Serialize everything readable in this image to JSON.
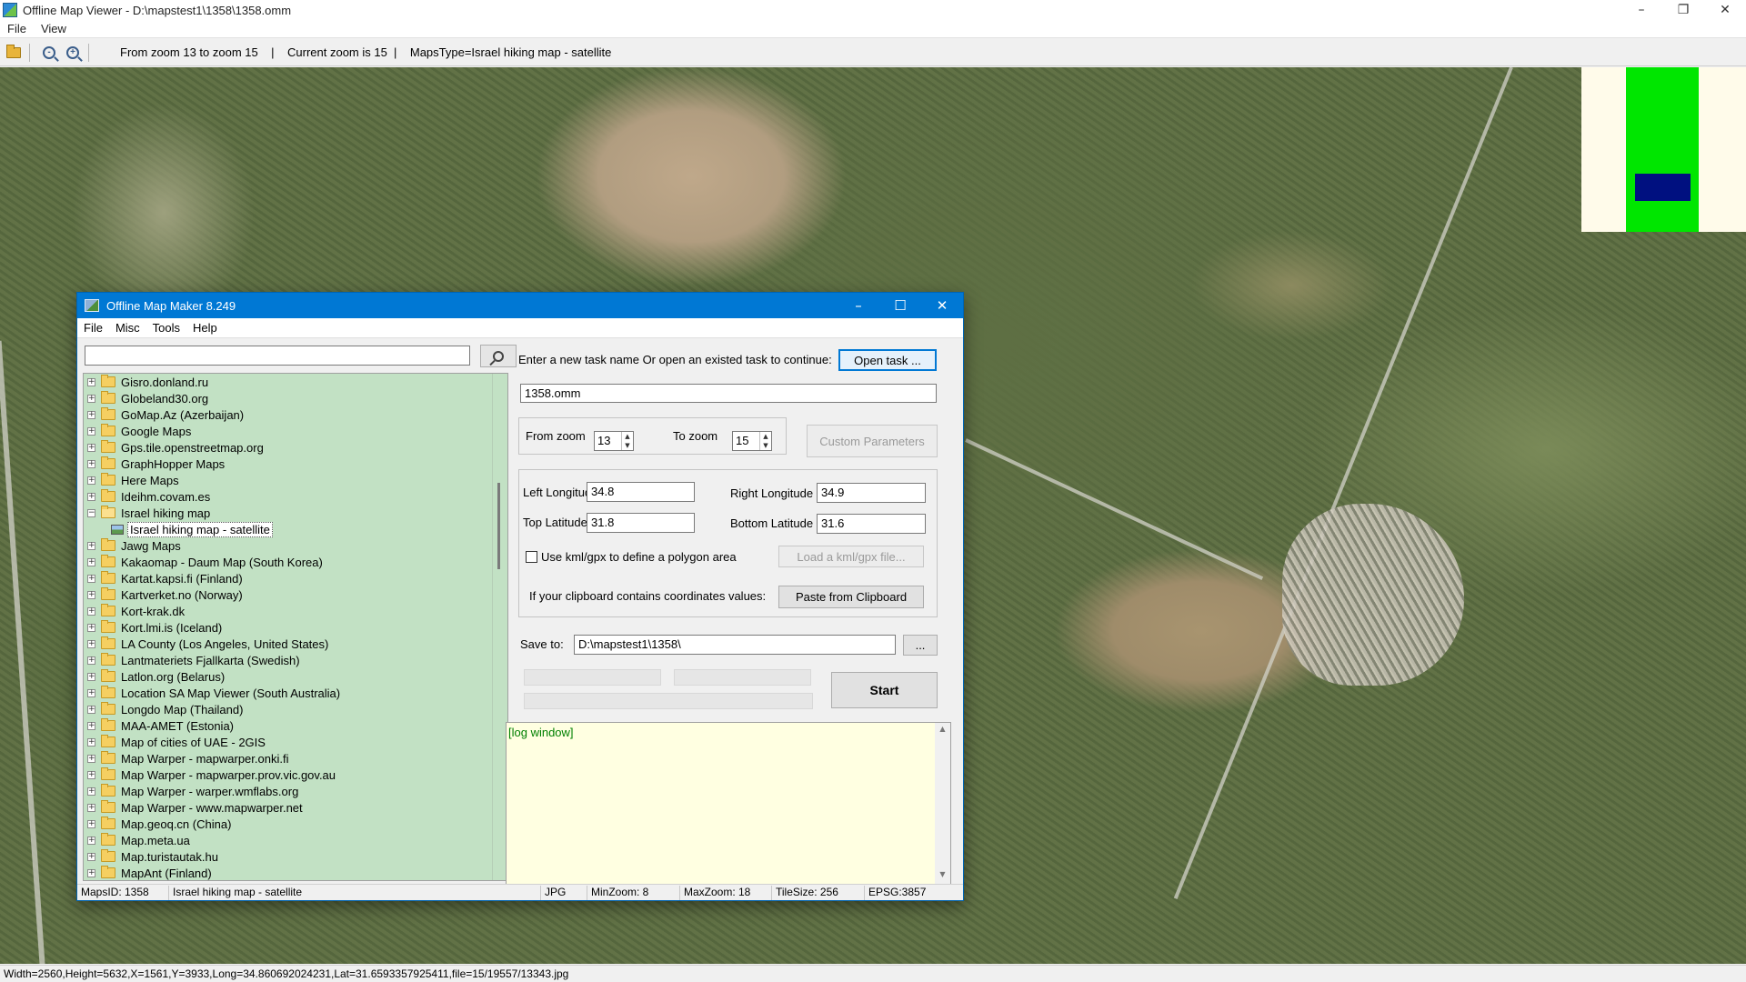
{
  "viewer": {
    "title": "Offline Map Viewer - D:\\mapstest1\\1358\\1358.omm",
    "menu": [
      "File",
      "View"
    ],
    "toolbar_status": "From zoom 13 to zoom 15    |    Current zoom is 15  |    MapsType=Israel hiking map - satellite",
    "statusbar": "Width=2560,Height=5632,X=1561,Y=3933,Long=34.860692024231,Lat=31.6593357925411,file=15/19557/13343.jpg",
    "minimap_colors": {
      "background": "#fffbea",
      "extent": "#00e600",
      "viewport": "#001080"
    }
  },
  "dialog": {
    "title": "Offline Map Maker 8.249",
    "menu": [
      "File",
      "Misc",
      "Tools",
      "Help"
    ],
    "search_value": "",
    "tree": [
      {
        "label": "Gisro.donland.ru"
      },
      {
        "label": "Globeland30.org"
      },
      {
        "label": "GoMap.Az (Azerbaijan)"
      },
      {
        "label": "Google Maps"
      },
      {
        "label": "Gps.tile.openstreetmap.org"
      },
      {
        "label": "GraphHopper Maps"
      },
      {
        "label": "Here Maps"
      },
      {
        "label": "Ideihm.covam.es"
      },
      {
        "label": "Israel hiking map",
        "expanded": true
      },
      {
        "label": "Israel hiking map - satellite",
        "child": true
      },
      {
        "label": "Jawg Maps"
      },
      {
        "label": "Kakaomap - Daum Map (South Korea)"
      },
      {
        "label": "Kartat.kapsi.fi (Finland)"
      },
      {
        "label": "Kartverket.no (Norway)"
      },
      {
        "label": "Kort-krak.dk"
      },
      {
        "label": "Kort.lmi.is (Iceland)"
      },
      {
        "label": "LA County (Los Angeles, United States)"
      },
      {
        "label": "Lantmateriets Fjallkarta (Swedish)"
      },
      {
        "label": "Latlon.org (Belarus)"
      },
      {
        "label": "Location SA Map Viewer (South Australia)"
      },
      {
        "label": "Longdo Map (Thailand)"
      },
      {
        "label": "MAA-AMET (Estonia)"
      },
      {
        "label": "Map of cities of UAE - 2GIS"
      },
      {
        "label": "Map Warper - mapwarper.onki.fi"
      },
      {
        "label": "Map Warper - mapwarper.prov.vic.gov.au"
      },
      {
        "label": "Map Warper - warper.wmflabs.org"
      },
      {
        "label": "Map Warper - www.mapwarper.net"
      },
      {
        "label": "Map.geoq.cn (China)"
      },
      {
        "label": "Map.meta.ua"
      },
      {
        "label": "Map.turistautak.hu"
      },
      {
        "label": "MapAnt (Finland)"
      }
    ],
    "task_prompt": "Enter a new task name Or open an existed task to continue:",
    "open_task_label": "Open task ...",
    "task_name": "1358.omm",
    "from_zoom_label": "From zoom",
    "from_zoom": "13",
    "to_zoom_label": "To zoom",
    "to_zoom": "15",
    "custom_params_label": "Custom Parameters",
    "left_longitude_label": "Left Longitude",
    "left_longitude": "34.8",
    "right_longitude_label": "Right Longitude",
    "right_longitude": "34.9",
    "top_latitude_label": "Top Latitude",
    "top_latitude": "31.8",
    "bottom_latitude_label": "Bottom Latitude",
    "bottom_latitude": "31.6",
    "use_kml_label": "Use kml/gpx to define a polygon area",
    "load_kml_label": "Load a kml/gpx file...",
    "clipboard_prompt": "If your clipboard contains coordinates values:",
    "paste_label": "Paste from Clipboard",
    "save_to_label": "Save to:",
    "save_to": "D:\\mapstest1\\1358\\",
    "browse_label": "...",
    "start_label": "Start",
    "log_text": "[log window]",
    "status": {
      "maps_id": "MapsID: 1358",
      "maps_name": "Israel hiking map - satellite",
      "format": "JPG",
      "min_zoom": "MinZoom: 8",
      "max_zoom": "MaxZoom: 18",
      "tile_size": "TileSize: 256",
      "epsg": "EPSG:3857"
    },
    "tree_bg_color": "#c2e1c4",
    "log_bg_color": "#ffffe1",
    "title_bar_color": "#0078d4"
  }
}
